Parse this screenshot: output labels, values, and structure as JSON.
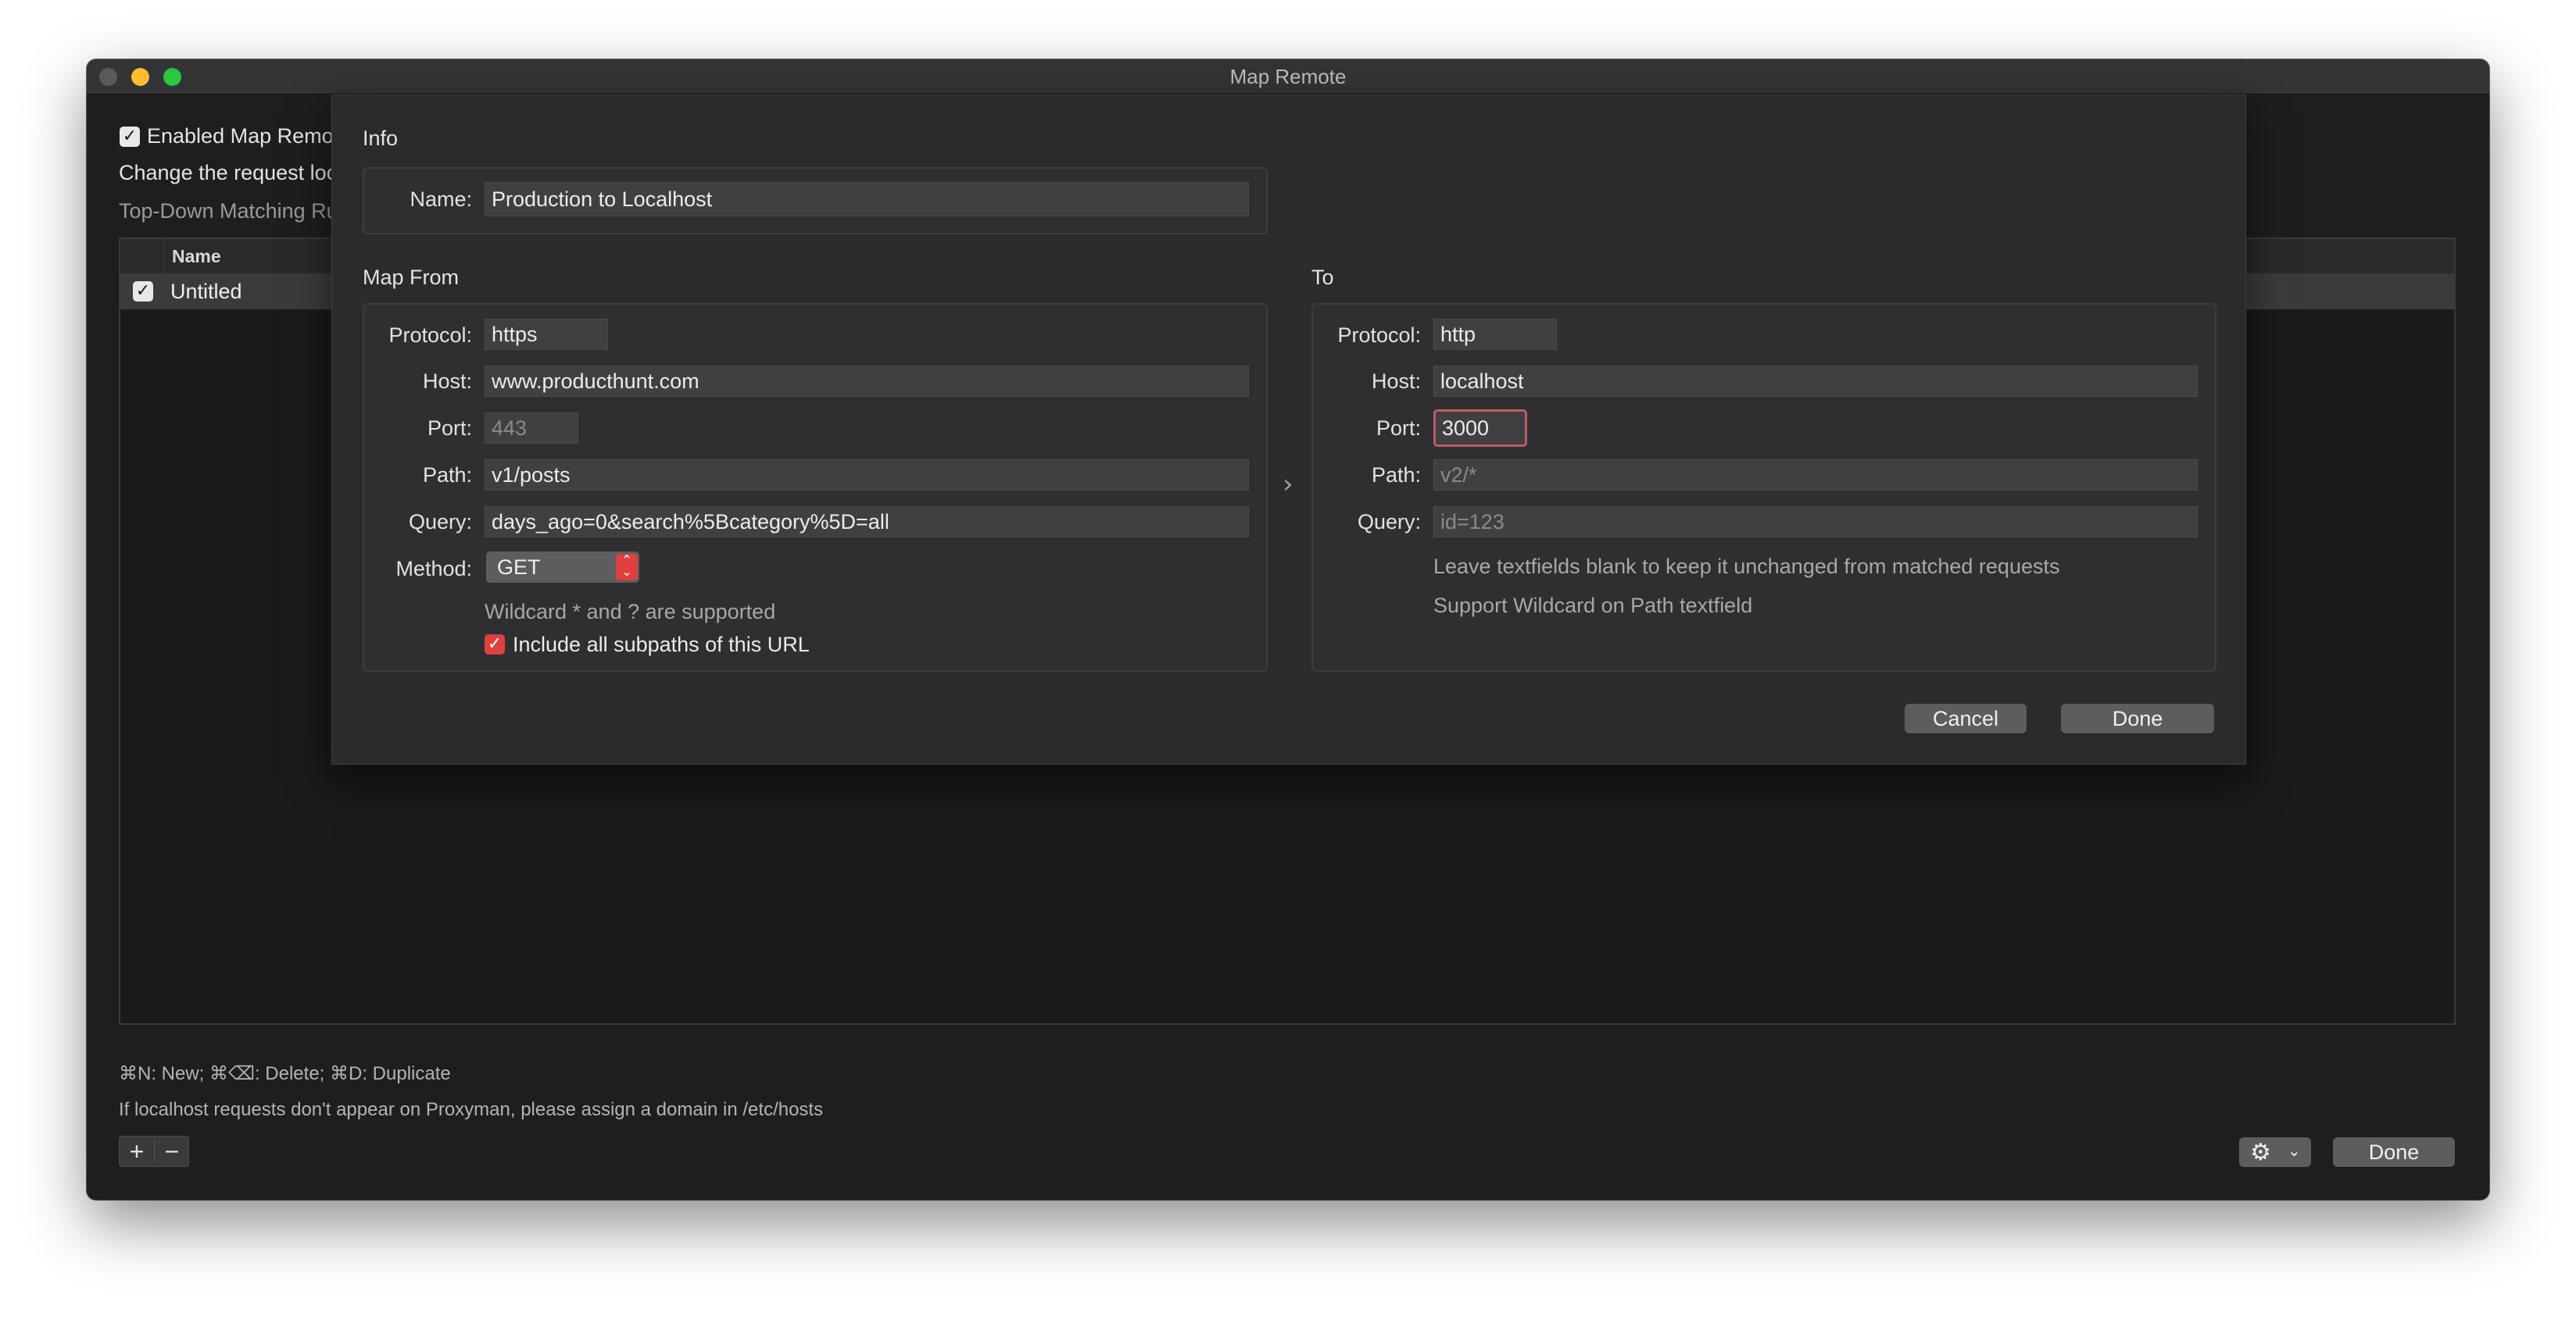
{
  "window": {
    "title": "Map Remote",
    "enabled_label": "Enabled Map Remote",
    "description": "Change the request location",
    "matching_rule": "Top-Down Matching Rule",
    "table": {
      "column_name": "Name",
      "rows": [
        {
          "name": "Untitled",
          "checked": true
        }
      ]
    },
    "shortcuts_hint": "⌘N: New; ⌘⌫: Delete; ⌘D: Duplicate",
    "localhost_hint": "If localhost requests don't appear on Proxyman, please assign a domain in /etc/hosts",
    "add_label": "+",
    "remove_label": "−",
    "done_label": "Done"
  },
  "sheet": {
    "info": {
      "section_title": "Info",
      "name_label": "Name:",
      "name_value": "Production to Localhost"
    },
    "map_from": {
      "section_title": "Map From",
      "protocol_label": "Protocol:",
      "protocol_value": "https",
      "host_label": "Host:",
      "host_value": "www.producthunt.com",
      "port_label": "Port:",
      "port_placeholder": "443",
      "path_label": "Path:",
      "path_value": "v1/posts",
      "query_label": "Query:",
      "query_value": "days_ago=0&search%5Bcategory%5D=all",
      "method_label": "Method:",
      "method_value": "GET",
      "wildcard_hint": "Wildcard * and ? are supported",
      "include_subpaths_label": "Include all subpaths of this URL",
      "include_subpaths_checked": true
    },
    "to": {
      "section_title": "To",
      "protocol_label": "Protocol:",
      "protocol_value": "http",
      "host_label": "Host:",
      "host_value": "localhost",
      "port_label": "Port:",
      "port_value": "3000",
      "path_label": "Path:",
      "path_placeholder": "v2/*",
      "query_label": "Query:",
      "query_placeholder": "id=123",
      "hint_blank": "Leave textfields blank to keep it unchanged from matched requests",
      "hint_wildcard": "Support Wildcard on Path textfield"
    },
    "cancel_label": "Cancel",
    "done_label": "Done"
  },
  "colors": {
    "accent_red": "#e0403f",
    "focus_ring": "#c05a64",
    "traffic_close": "#ff5f57",
    "traffic_minimize": "#febc2e",
    "traffic_zoom": "#28c840"
  }
}
